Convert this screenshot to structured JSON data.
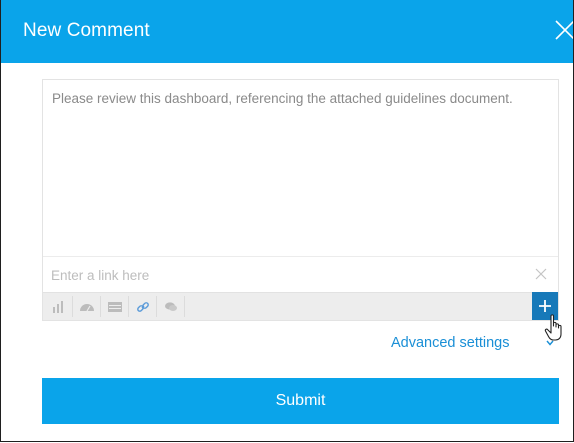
{
  "dialog": {
    "title": "New Comment",
    "close_icon": "close-icon"
  },
  "comment": {
    "text": "Please review this dashboard, referencing the attached guidelines document."
  },
  "link": {
    "placeholder": "Enter a link here",
    "clear_icon": "close-icon"
  },
  "toolbar": {
    "items": [
      {
        "icon": "bar-chart-icon"
      },
      {
        "icon": "gauge-icon"
      },
      {
        "icon": "table-icon"
      },
      {
        "icon": "link-icon"
      },
      {
        "icon": "comment-bubbles-icon"
      }
    ],
    "add_icon": "plus-icon"
  },
  "advanced": {
    "label": "Advanced settings"
  },
  "submit": {
    "label": "Submit"
  },
  "colors": {
    "header": "#0aa4ea",
    "submit": "#0aa4ea",
    "link": "#1a8fd6",
    "add_button": "#1779b9"
  }
}
